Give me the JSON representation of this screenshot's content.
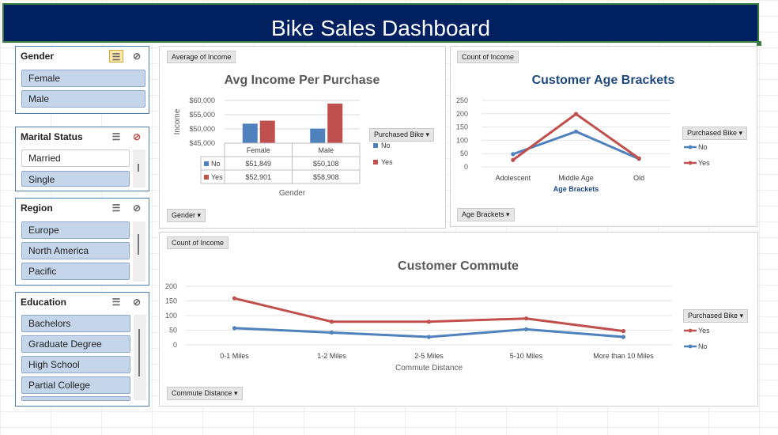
{
  "dashboard": {
    "title": "Bike Sales Dashboard"
  },
  "slicers": {
    "gender": {
      "title": "Gender",
      "items": [
        "Female",
        "Male"
      ]
    },
    "marital": {
      "title": "Marital Status",
      "items": [
        "Married",
        "Single"
      ]
    },
    "region": {
      "title": "Region",
      "items": [
        "Europe",
        "North America",
        "Pacific"
      ]
    },
    "education": {
      "title": "Education",
      "items": [
        "Bachelors",
        "Graduate Degree",
        "High School",
        "Partial College"
      ]
    }
  },
  "colors": {
    "no": "#4f81bd",
    "yes": "#c0504d",
    "title_bg": "#002060",
    "slicer_item": "#c5d5ea"
  },
  "income_chart": {
    "field_button": "Average of Income",
    "axis_button": "Gender",
    "legend_button": "Purchased Bike",
    "chart_data": {
      "type": "bar",
      "title": "Avg Income Per Purchase",
      "xlabel": "Gender",
      "ylabel": "Income",
      "categories": [
        "Female",
        "Male"
      ],
      "ylim": [
        45000,
        60000
      ],
      "yticks": [
        "$60,000",
        "$55,000",
        "$50,000",
        "$45,000"
      ],
      "series": [
        {
          "name": "No",
          "values": [
            51849,
            50108
          ],
          "labels": [
            "$51,849",
            "$50,108"
          ]
        },
        {
          "name": "Yes",
          "values": [
            52901,
            58908
          ],
          "labels": [
            "$52,901",
            "$58,908"
          ]
        }
      ],
      "legend": "right"
    }
  },
  "age_chart": {
    "field_button": "Count of Income",
    "axis_button": "Age Brackets",
    "legend_button": "Purchased Bike",
    "chart_data": {
      "type": "line",
      "title": "Customer Age Brackets",
      "xlabel": "Age Brackets",
      "categories": [
        "Adolescent",
        "Middle Age",
        "Old"
      ],
      "ylim": [
        0,
        250
      ],
      "yticks": [
        "250",
        "200",
        "150",
        "100",
        "50",
        "0"
      ],
      "series": [
        {
          "name": "No",
          "values": [
            48,
            133,
            30
          ]
        },
        {
          "name": "Yes",
          "values": [
            26,
            199,
            32
          ]
        }
      ],
      "legend": "right"
    }
  },
  "commute_chart": {
    "field_button": "Count of Income",
    "axis_button": "Commute Distance",
    "legend_button": "Purchased Bike",
    "chart_data": {
      "type": "line",
      "title": "Customer Commute",
      "xlabel": "Commute Distance",
      "categories": [
        "0-1 Miles",
        "1-2 Miles",
        "2-5 Miles",
        "5-10 Miles",
        "More than 10 Miles"
      ],
      "ylim": [
        0,
        200
      ],
      "yticks": [
        "200",
        "150",
        "100",
        "50",
        "0"
      ],
      "series": [
        {
          "name": "Yes",
          "values": [
            159,
            79,
            79,
            90,
            47
          ]
        },
        {
          "name": "No",
          "values": [
            57,
            42,
            27,
            53,
            27
          ]
        }
      ],
      "legend": "right"
    }
  }
}
